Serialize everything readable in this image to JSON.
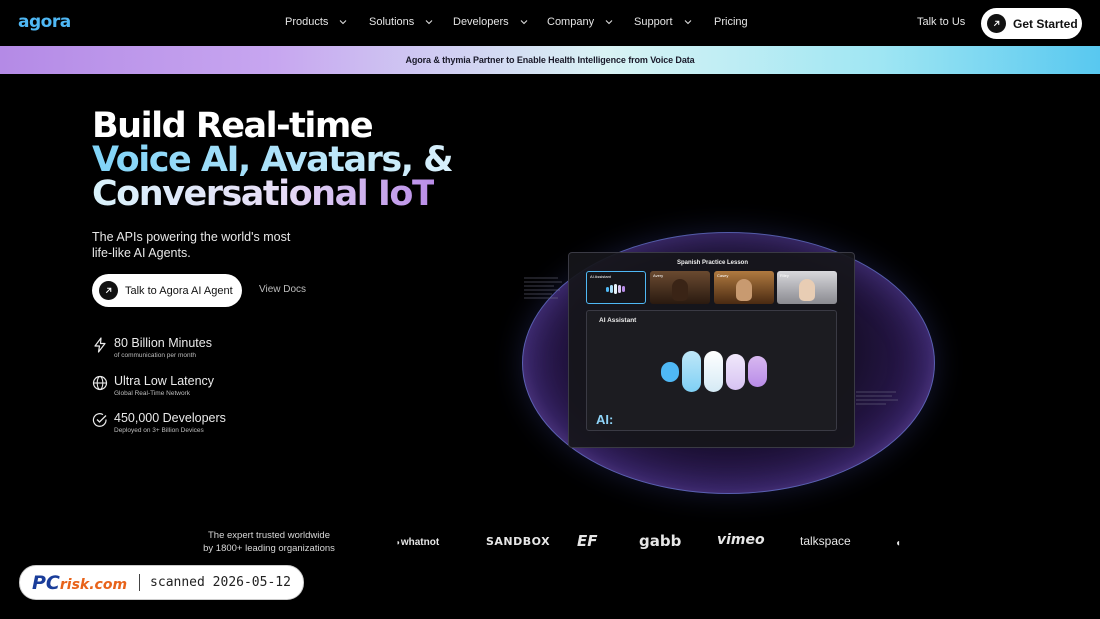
{
  "nav": {
    "logo": "agora",
    "items": [
      {
        "label": "Products",
        "dropdown": true
      },
      {
        "label": "Solutions",
        "dropdown": true
      },
      {
        "label": "Developers",
        "dropdown": true
      },
      {
        "label": "Company",
        "dropdown": true
      },
      {
        "label": "Support",
        "dropdown": true
      },
      {
        "label": "Pricing",
        "dropdown": false
      }
    ],
    "talk_label": "Talk to Us",
    "get_started_label": "Get Started"
  },
  "banner": {
    "text": "Agora & thymia Partner to Enable Health Intelligence from Voice Data"
  },
  "hero": {
    "line1": "Build Real-time",
    "line2": "Voice AI, Avatars, &",
    "line3": "Conversational IoT",
    "subtitle": "The APIs powering the world's most life-like AI Agents.",
    "cta_label": "Talk to Agora AI Agent",
    "view_docs_label": "View Docs"
  },
  "stats": [
    {
      "icon": "lightning-icon",
      "title": "80 Billion Minutes",
      "subtitle": "of communication per month"
    },
    {
      "icon": "globe-icon",
      "title": "Ultra Low Latency",
      "subtitle": "Global Real-Time Network"
    },
    {
      "icon": "check-circle-icon",
      "title": "450,000 Developers",
      "subtitle": "Deployed on 3+ Billion Devices"
    }
  ],
  "mockup": {
    "title": "Spanish Practice Lesson",
    "tiles": [
      "AI Assistant",
      "Avery",
      "Casey",
      "Riley"
    ],
    "panel_label": "AI Assistant",
    "ai_label": "AI:"
  },
  "trusted": {
    "line1": "The expert trusted worldwide",
    "line2": "by 1800+ leading organizations"
  },
  "logos": [
    "whatnot",
    "SANDBOX",
    "EF",
    "gabb",
    "vimeo",
    "talkspace"
  ],
  "badge": {
    "logo": "PC",
    "logo_suffix": "risk.com",
    "text": "scanned 2026-05-12"
  },
  "colors": {
    "accent": "#4fb8f5",
    "banner_start": "#b48ae6",
    "banner_end": "#58c8f0"
  }
}
